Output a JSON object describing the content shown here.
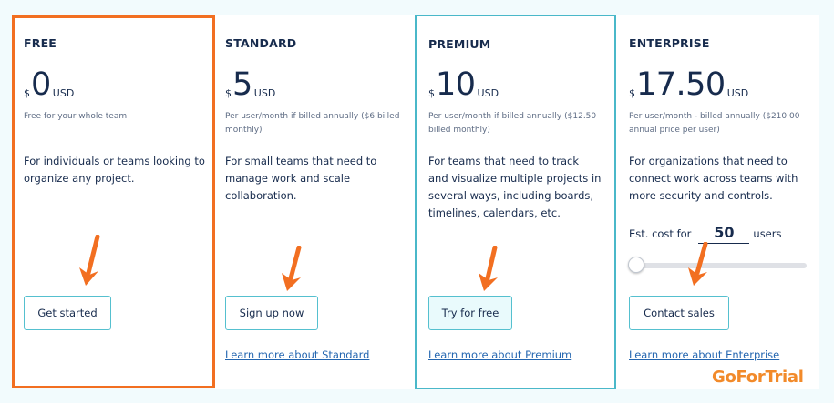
{
  "plans": {
    "free": {
      "tier": "FREE",
      "currency": "$",
      "amount": "0",
      "unit": "USD",
      "note": "Free for your whole team",
      "description": "For individuals or teams looking to organize any project.",
      "button": "Get started"
    },
    "standard": {
      "tier": "STANDARD",
      "currency": "$",
      "amount": "5",
      "unit": "USD",
      "note": "Per user/month if billed annually ($6 billed monthly)",
      "description": "For small teams that need to manage work and scale collaboration.",
      "button": "Sign up now",
      "link": "Learn more about Standard"
    },
    "premium": {
      "tier": "PREMIUM",
      "currency": "$",
      "amount": "10",
      "unit": "USD",
      "note": "Per user/month if billed annually ($12.50 billed monthly)",
      "description": "For teams that need to track and visualize multiple projects in several ways, including boards, timelines, calendars, etc.",
      "button": "Try for free",
      "link": "Learn more about Premium"
    },
    "enterprise": {
      "tier": "ENTERPRISE",
      "currency": "$",
      "amount": "17.50",
      "unit": "USD",
      "note": "Per user/month - billed annually ($210.00 annual price per user)",
      "description": "For organizations that need to connect work across teams with more security and controls.",
      "estimate_prefix": "Est. cost for",
      "users_value": "50",
      "estimate_suffix": "users",
      "button": "Contact sales",
      "link": "Learn more about Enterprise"
    }
  },
  "watermark": "GoForTrial",
  "colors": {
    "highlight_orange": "#f26f21",
    "premium_border": "#4ab8c9",
    "button_border": "#55c0cf",
    "link": "#2466b0",
    "text": "#172b4d",
    "muted": "#5e6c84",
    "background": "#f2fbfd",
    "watermark": "#f28a2a"
  },
  "annotations": {
    "arrow_icon": "orange-down-arrow-icon"
  }
}
